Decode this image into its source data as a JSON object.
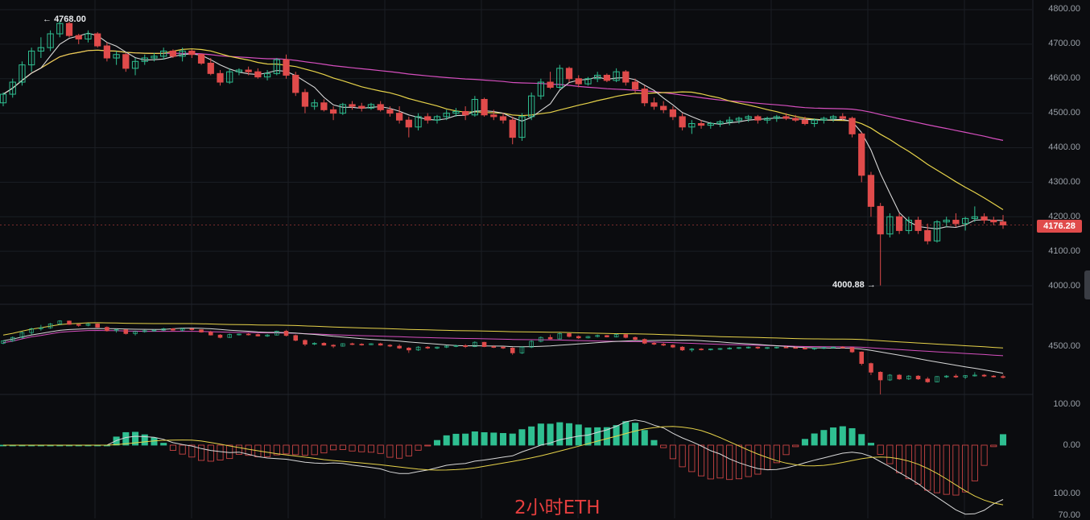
{
  "watermark": "2小时ETH",
  "colors": {
    "background": "#0b0c0f",
    "up": "#2fbf91",
    "down": "#e04b4b",
    "ma_short": "#d8d8d8",
    "ma_mid": "#e7d34a",
    "ma_long": "#d64fbf",
    "grid": "#1b1e24"
  },
  "price_axis": {
    "ticks": [
      "4800.00",
      "4700.00",
      "4600.00",
      "4500.00",
      "4400.00",
      "4300.00",
      "4200.00",
      "4100.00",
      "4000.00"
    ],
    "current_price": "4176.28"
  },
  "annotations": {
    "high": "4768.00",
    "low": "4000.88"
  },
  "mini_axis": {
    "tick": "4500.00"
  },
  "macd_axis": {
    "ticks": [
      "100.00",
      "0.00",
      "100.00",
      "70.00"
    ]
  },
  "chart_data": {
    "type": "candlestick",
    "interval": "2h",
    "ylim": [
      4000,
      4800
    ],
    "candles": [
      [
        4530,
        4560,
        4520,
        4555
      ],
      [
        4555,
        4600,
        4545,
        4590
      ],
      [
        4590,
        4650,
        4580,
        4640
      ],
      [
        4640,
        4690,
        4620,
        4680
      ],
      [
        4680,
        4720,
        4660,
        4690
      ],
      [
        4690,
        4740,
        4680,
        4730
      ],
      [
        4730,
        4768,
        4720,
        4760
      ],
      [
        4760,
        4765,
        4720,
        4725
      ],
      [
        4725,
        4730,
        4700,
        4715
      ],
      [
        4715,
        4740,
        4705,
        4730
      ],
      [
        4730,
        4735,
        4690,
        4695
      ],
      [
        4695,
        4705,
        4650,
        4660
      ],
      [
        4660,
        4680,
        4640,
        4670
      ],
      [
        4670,
        4675,
        4620,
        4630
      ],
      [
        4630,
        4660,
        4610,
        4650
      ],
      [
        4650,
        4670,
        4640,
        4660
      ],
      [
        4660,
        4675,
        4650,
        4665
      ],
      [
        4665,
        4690,
        4655,
        4680
      ],
      [
        4680,
        4685,
        4660,
        4665
      ],
      [
        4665,
        4690,
        4650,
        4680
      ],
      [
        4680,
        4685,
        4660,
        4670
      ],
      [
        4670,
        4672,
        4640,
        4645
      ],
      [
        4645,
        4660,
        4610,
        4615
      ],
      [
        4615,
        4625,
        4580,
        4590
      ],
      [
        4590,
        4630,
        4585,
        4620
      ],
      [
        4620,
        4630,
        4610,
        4625
      ],
      [
        4625,
        4635,
        4610,
        4620
      ],
      [
        4620,
        4630,
        4600,
        4605
      ],
      [
        4605,
        4625,
        4595,
        4615
      ],
      [
        4615,
        4660,
        4610,
        4655
      ],
      [
        4655,
        4670,
        4600,
        4610
      ],
      [
        4610,
        4620,
        4550,
        4560
      ],
      [
        4560,
        4570,
        4500,
        4520
      ],
      [
        4520,
        4540,
        4510,
        4530
      ],
      [
        4530,
        4540,
        4505,
        4510
      ],
      [
        4510,
        4520,
        4480,
        4500
      ],
      [
        4500,
        4530,
        4495,
        4525
      ],
      [
        4525,
        4535,
        4510,
        4520
      ],
      [
        4520,
        4530,
        4505,
        4515
      ],
      [
        4515,
        4530,
        4510,
        4525
      ],
      [
        4525,
        4535,
        4505,
        4510
      ],
      [
        4510,
        4520,
        4490,
        4500
      ],
      [
        4500,
        4520,
        4470,
        4480
      ],
      [
        4480,
        4490,
        4430,
        4460
      ],
      [
        4460,
        4500,
        4450,
        4490
      ],
      [
        4490,
        4500,
        4470,
        4480
      ],
      [
        4480,
        4495,
        4470,
        4490
      ],
      [
        4490,
        4510,
        4480,
        4500
      ],
      [
        4500,
        4515,
        4490,
        4505
      ],
      [
        4505,
        4520,
        4480,
        4495
      ],
      [
        4495,
        4550,
        4490,
        4540
      ],
      [
        4540,
        4545,
        4490,
        4495
      ],
      [
        4495,
        4510,
        4480,
        4490
      ],
      [
        4490,
        4500,
        4470,
        4480
      ],
      [
        4480,
        4490,
        4410,
        4430
      ],
      [
        4430,
        4500,
        4420,
        4490
      ],
      [
        4490,
        4560,
        4480,
        4550
      ],
      [
        4550,
        4600,
        4540,
        4590
      ],
      [
        4590,
        4620,
        4570,
        4575
      ],
      [
        4575,
        4640,
        4570,
        4630
      ],
      [
        4630,
        4635,
        4590,
        4600
      ],
      [
        4600,
        4610,
        4575,
        4585
      ],
      [
        4585,
        4605,
        4580,
        4600
      ],
      [
        4600,
        4620,
        4590,
        4610
      ],
      [
        4610,
        4615,
        4590,
        4595
      ],
      [
        4595,
        4630,
        4590,
        4620
      ],
      [
        4620,
        4625,
        4580,
        4590
      ],
      [
        4590,
        4600,
        4560,
        4570
      ],
      [
        4570,
        4580,
        4520,
        4530
      ],
      [
        4530,
        4545,
        4510,
        4520
      ],
      [
        4520,
        4535,
        4500,
        4510
      ],
      [
        4510,
        4520,
        4480,
        4490
      ],
      [
        4490,
        4500,
        4450,
        4460
      ],
      [
        4460,
        4480,
        4440,
        4470
      ],
      [
        4470,
        4480,
        4455,
        4465
      ],
      [
        4465,
        4475,
        4455,
        4470
      ],
      [
        4470,
        4480,
        4460,
        4475
      ],
      [
        4475,
        4490,
        4465,
        4480
      ],
      [
        4480,
        4490,
        4470,
        4485
      ],
      [
        4485,
        4495,
        4475,
        4490
      ],
      [
        4490,
        4495,
        4470,
        4480
      ],
      [
        4480,
        4490,
        4470,
        4485
      ],
      [
        4485,
        4495,
        4475,
        4490
      ],
      [
        4490,
        4500,
        4480,
        4485
      ],
      [
        4485,
        4495,
        4475,
        4480
      ],
      [
        4480,
        4490,
        4465,
        4470
      ],
      [
        4470,
        4485,
        4460,
        4480
      ],
      [
        4480,
        4490,
        4470,
        4485
      ],
      [
        4485,
        4495,
        4475,
        4490
      ],
      [
        4490,
        4500,
        4480,
        4485
      ],
      [
        4485,
        4490,
        4430,
        4440
      ],
      [
        4440,
        4445,
        4300,
        4320
      ],
      [
        4320,
        4330,
        4200,
        4230
      ],
      [
        4230,
        4240,
        4000.88,
        4150
      ],
      [
        4150,
        4210,
        4140,
        4200
      ],
      [
        4200,
        4210,
        4150,
        4160
      ],
      [
        4160,
        4200,
        4150,
        4190
      ],
      [
        4190,
        4200,
        4150,
        4160
      ],
      [
        4160,
        4180,
        4120,
        4130
      ],
      [
        4130,
        4190,
        4125,
        4185
      ],
      [
        4185,
        4200,
        4170,
        4190
      ],
      [
        4190,
        4210,
        4170,
        4180
      ],
      [
        4180,
        4200,
        4160,
        4195
      ],
      [
        4195,
        4230,
        4185,
        4200
      ],
      [
        4200,
        4210,
        4180,
        4190
      ],
      [
        4190,
        4200,
        4175,
        4185
      ],
      [
        4185,
        4205,
        4165,
        4176.28
      ]
    ]
  }
}
